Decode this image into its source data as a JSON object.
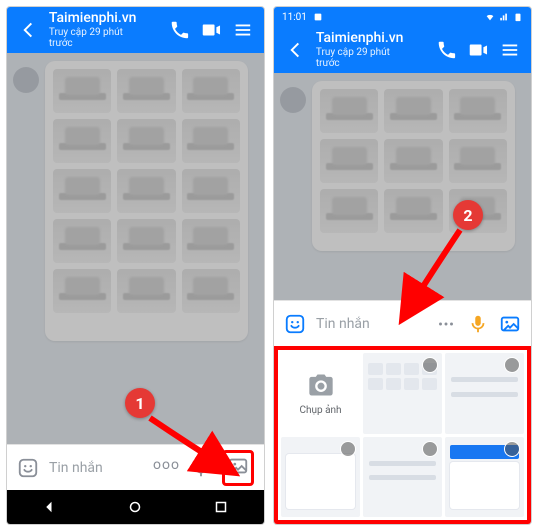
{
  "statusbar": {
    "time": "11:01"
  },
  "header": {
    "title": "Taimienphi.vn",
    "subtitle": "Truy cập 29 phút trước"
  },
  "composer": {
    "placeholder": "Tin nhắn",
    "more": "ooo"
  },
  "gallery": {
    "capture_label": "Chụp ảnh"
  },
  "annotations": {
    "badge1": "1",
    "badge2": "2"
  }
}
